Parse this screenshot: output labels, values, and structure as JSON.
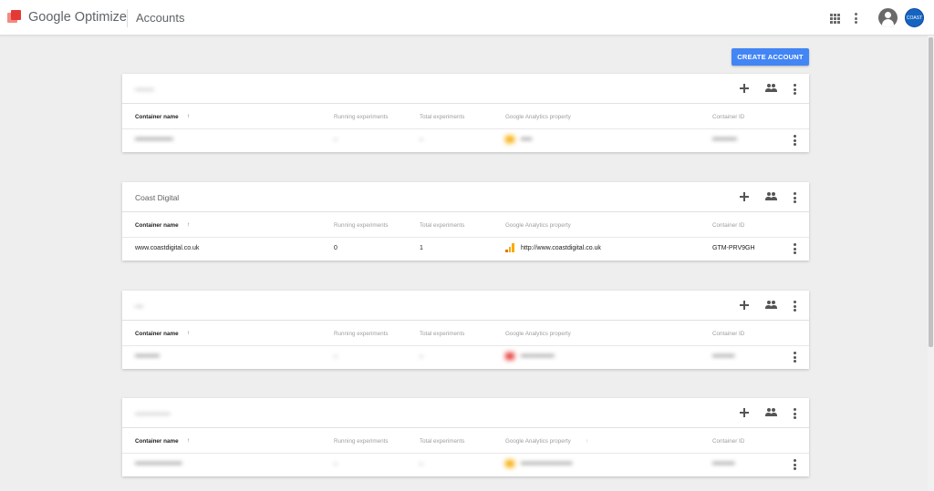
{
  "app": {
    "brand": "Google Optimize",
    "page_title": "Accounts",
    "avatar_text": "COAST"
  },
  "toolbar": {
    "create_account_label": "CREATE ACCOUNT"
  },
  "columns": {
    "container_name": "Container name",
    "running": "Running experiments",
    "total": "Total experiments",
    "ga_property": "Google Analytics property",
    "container_id": "Container ID",
    "sort_arrow": "↑"
  },
  "accounts": [
    {
      "name": "•••••••",
      "blurred": true,
      "row": {
        "container": "•••••••••••••••••",
        "running": "–",
        "total": "–",
        "ga": "•••••",
        "ga_icon": "analytics-icon",
        "id": "•••••••••••"
      }
    },
    {
      "name": "Coast Digital",
      "blurred": false,
      "row": {
        "container": "www.coastdigital.co.uk",
        "running": "0",
        "total": "1",
        "ga": "http://www.coastdigital.co.uk",
        "ga_icon": "analytics-icon",
        "id": "GTM-PRV9GH"
      }
    },
    {
      "name": "•••",
      "blurred": true,
      "row": {
        "container": "•••••••••••",
        "running": "–",
        "total": "–",
        "ga": "•••••••••••••••",
        "ga_icon": "property-error-icon",
        "id": "••••••••••"
      }
    },
    {
      "name": "•••••••••••••",
      "blurred": true,
      "row": {
        "container": "•••••••••••••••••••••",
        "running": "–",
        "total": "–",
        "ga": "•••••••••••••••••••••••",
        "ga_icon": "analytics-icon",
        "id": "••••••••••"
      }
    }
  ],
  "colors": {
    "primary_button": "#4285f4",
    "logo_red": "#e53935",
    "analytics_orange": "#f9ab00",
    "error_red": "#e53935"
  }
}
